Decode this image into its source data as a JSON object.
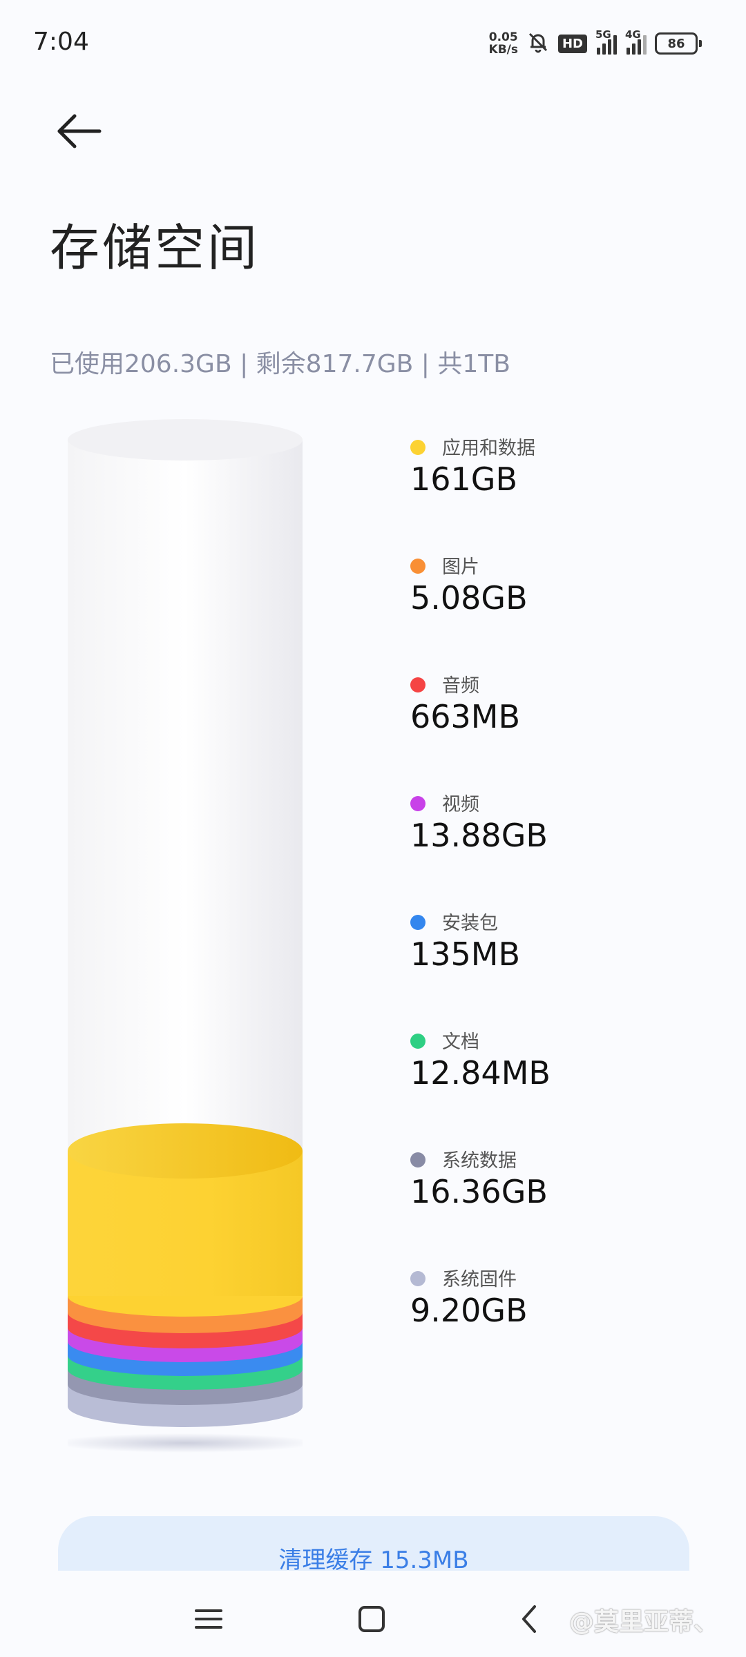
{
  "status_bar": {
    "time": "7:04",
    "net_speed_value": "0.05",
    "net_speed_unit": "KB/s",
    "hd_badge": "HD",
    "signal1_gen": "5G",
    "signal2_gen": "4G",
    "battery": "86"
  },
  "header": {
    "title": "存储空间"
  },
  "summary": {
    "text": "已使用206.3GB | 剩余817.7GB | 共1TB"
  },
  "legend": [
    {
      "label": "应用和数据",
      "value": "161GB",
      "color": "#fcd232",
      "icon": "dot-icon"
    },
    {
      "label": "图片",
      "value": "5.08GB",
      "color": "#f98f35",
      "icon": "dot-icon"
    },
    {
      "label": "音频",
      "value": "663MB",
      "color": "#f54444",
      "icon": "dot-icon"
    },
    {
      "label": "视频",
      "value": "13.88GB",
      "color": "#c841e8",
      "icon": "dot-icon"
    },
    {
      "label": "安装包",
      "value": "135MB",
      "color": "#3386ee",
      "icon": "dot-icon"
    },
    {
      "label": "文档",
      "value": "12.84MB",
      "color": "#2ecf83",
      "icon": "dot-icon"
    },
    {
      "label": "系统数据",
      "value": "16.36GB",
      "color": "#888ba5",
      "icon": "dot-icon"
    },
    {
      "label": "系统固件",
      "value": "9.20GB",
      "color": "#b4b9d3",
      "icon": "dot-icon"
    }
  ],
  "clean_button": {
    "label": "清理缓存 15.3MB"
  },
  "nav": {
    "menu_icon": "menu-icon",
    "home_icon": "home-icon",
    "back_icon": "back-icon"
  },
  "watermark": "@莫里亚蒂、"
}
